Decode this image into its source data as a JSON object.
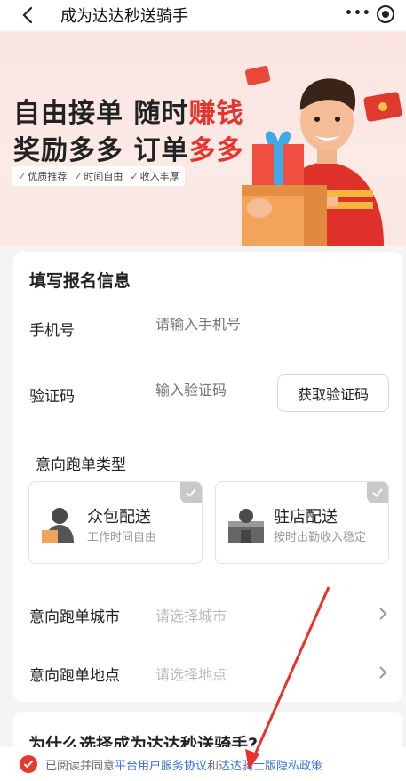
{
  "nav": {
    "title": "成为达达秒送骑手",
    "more_label": "•••"
  },
  "banner": {
    "line1_prefix": "自由接单 随时",
    "line1_highlight": "赚钱",
    "line2_prefix": "奖励多多 订单",
    "line2_highlight": "多多",
    "tags": [
      "优质推荐",
      "时间自由",
      "收入丰厚"
    ]
  },
  "form": {
    "section_title": "填写报名信息",
    "phone": {
      "label": "手机号",
      "placeholder": "请输入手机号"
    },
    "code": {
      "label": "验证码",
      "placeholder": "输入验证码",
      "button": "获取验证码"
    },
    "type_title": "意向跑单类型",
    "options": [
      {
        "title": "众包配送",
        "subtitle": "工作时间自由"
      },
      {
        "title": "驻店配送",
        "subtitle": "按时出勤收入稳定"
      }
    ],
    "city": {
      "label": "意向跑单城市",
      "placeholder": "请选择城市"
    },
    "location": {
      "label": "意向跑单地点",
      "placeholder": "请选择地点"
    }
  },
  "section2": {
    "title": "为什么选择成为达达秒送骑手?"
  },
  "agreement": {
    "prefix": "已阅读并同意",
    "link1": "平台用户服务协议",
    "conj": "和",
    "link2": "达达骑士版隐私政策"
  },
  "colors": {
    "accent": "#e8322b",
    "link": "#3b6fd9",
    "check_gray": "#c9c9c9"
  }
}
